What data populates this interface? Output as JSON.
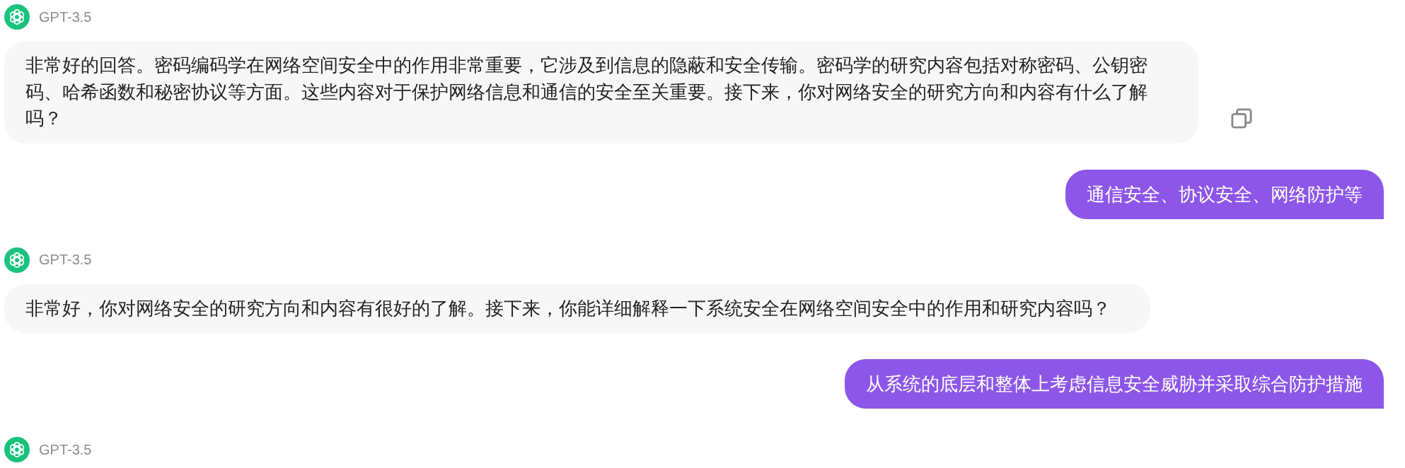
{
  "messages": [
    {
      "kind": "assistant",
      "model": "GPT-3.5",
      "text": "非常好的回答。密码编码学在网络空间安全中的作用非常重要，它涉及到信息的隐蔽和安全传输。密码学的研究内容包括对称密码、公钥密码、哈希函数和秘密协议等方面。这些内容对于保护网络信息和通信的安全至关重要。接下来，你对网络安全的研究方向和内容有什么了解吗？",
      "copy_button": true
    },
    {
      "kind": "user",
      "text": "通信安全、协议安全、网络防护等"
    },
    {
      "kind": "assistant",
      "model": "GPT-3.5",
      "text": "非常好，你对网络安全的研究方向和内容有很好的了解。接下来，你能详细解释一下系统安全在网络空间安全中的作用和研究内容吗？"
    },
    {
      "kind": "user",
      "text": "从系统的底层和整体上考虑信息安全威胁并采取综合防护措施"
    },
    {
      "kind": "assistant",
      "model": "GPT-3.5"
    }
  ]
}
